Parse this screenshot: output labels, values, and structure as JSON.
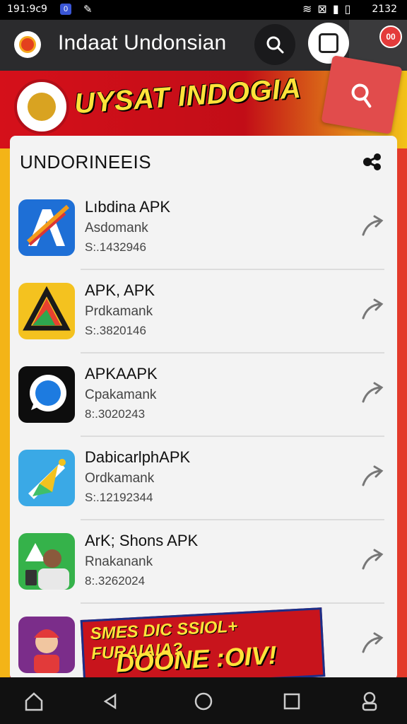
{
  "status_bar": {
    "time_left": "191:9c9",
    "badge": "0",
    "clock": "2132"
  },
  "app_bar": {
    "title": "Indaat Undonsian",
    "notification_count": "00"
  },
  "banner": {
    "title": "UYSAT INDOGIA"
  },
  "card": {
    "header": "UNDORINEEIS",
    "items": [
      {
        "name": "Lıbdina APK",
        "developer": "Asdomank",
        "size": "S:.1432946",
        "icon": "app-icon-a"
      },
      {
        "name": "APK, APK",
        "developer": "Prdkamank",
        "size": "S:.3820146",
        "icon": "app-icon-triangle"
      },
      {
        "name": "APKAAPK",
        "developer": "Cpakamank",
        "size": "8:.3020243",
        "icon": "app-icon-chat"
      },
      {
        "name": "DabicarlphAPK",
        "developer": "Ordkamank",
        "size": "S:.12192344",
        "icon": "app-icon-kite"
      },
      {
        "name": "ArK; Shons APK",
        "developer": "Rnakanank",
        "size": "8:.3262024",
        "icon": "app-icon-person"
      },
      {
        "name": "",
        "developer": "",
        "size": "",
        "icon": "app-icon-cartoon"
      }
    ]
  },
  "promo": {
    "line1": "SMES DIC SSIOL+ FURAIAIA?",
    "line2": "DOONE :OIV!"
  },
  "colors": {
    "brand_red": "#c8141c",
    "brand_yellow": "#ffe23a",
    "appbar": "#2b2b2d"
  }
}
